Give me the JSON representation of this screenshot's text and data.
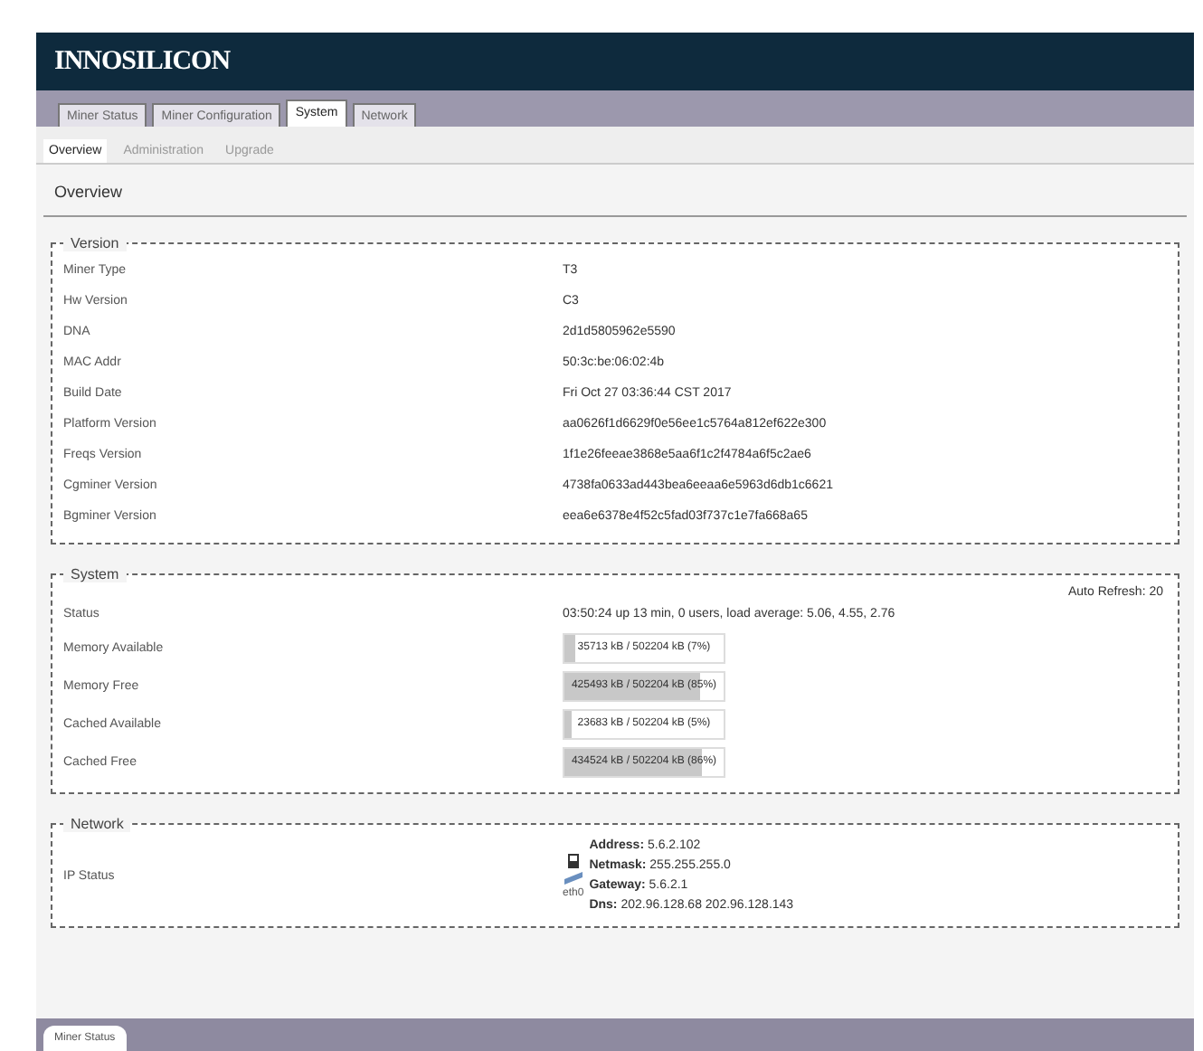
{
  "logo": "INNOSILICON",
  "tabs": [
    {
      "label": "Miner Status",
      "selected": false
    },
    {
      "label": "Miner Configuration",
      "selected": false
    },
    {
      "label": "System",
      "selected": true
    },
    {
      "label": "Network",
      "selected": false
    }
  ],
  "subtabs": [
    {
      "label": "Overview",
      "selected": true
    },
    {
      "label": "Administration",
      "selected": false
    },
    {
      "label": "Upgrade",
      "selected": false
    }
  ],
  "page_title": "Overview",
  "version": {
    "legend": "Version",
    "rows": [
      {
        "label": "Miner Type",
        "value": "T3"
      },
      {
        "label": "Hw Version",
        "value": "C3"
      },
      {
        "label": "DNA",
        "value": "2d1d5805962e5590"
      },
      {
        "label": "MAC Addr",
        "value": "50:3c:be:06:02:4b"
      },
      {
        "label": "Build Date",
        "value": "Fri Oct 27 03:36:44 CST 2017"
      },
      {
        "label": "Platform Version",
        "value": "aa0626f1d6629f0e56ee1c5764a812ef622e300"
      },
      {
        "label": "Freqs Version",
        "value": "1f1e26feeae3868e5aa6f1c2f4784a6f5c2ae6"
      },
      {
        "label": "Cgminer Version",
        "value": "4738fa0633ad443bea6eeaa6e5963d6db1c6621"
      },
      {
        "label": "Bgminer Version",
        "value": "eea6e6378e4f52c5fad03f737c1e7fa668a65"
      }
    ]
  },
  "system": {
    "legend": "System",
    "auto_refresh": "Auto Refresh: 20",
    "status": {
      "label": "Status",
      "value": "03:50:24 up 13 min, 0 users, load average: 5.06, 4.55, 2.76"
    },
    "meters": [
      {
        "label": "Memory Available",
        "reading": "35713 kB / 502204 kB (7%)",
        "level": 0.07
      },
      {
        "label": "Memory Free",
        "reading": "425493 kB / 502204 kB (85%)",
        "level": 0.85
      },
      {
        "label": "Cached Available",
        "reading": "23683 kB / 502204 kB (5%)",
        "level": 0.05
      },
      {
        "label": "Cached Free",
        "reading": "434524 kB / 502204 kB (86%)",
        "level": 0.86
      }
    ]
  },
  "network": {
    "legend": "Network",
    "label": "IP Status",
    "interface": "eth0",
    "fields": [
      {
        "name": "Address:",
        "value": "5.6.2.102"
      },
      {
        "name": "Netmask:",
        "value": "255.255.255.0"
      },
      {
        "name": "Gateway:",
        "value": "5.6.2.1"
      },
      {
        "name": "Dns:",
        "value": "202.96.128.68 202.96.128.143"
      }
    ]
  },
  "footer_tab": "Miner Status"
}
